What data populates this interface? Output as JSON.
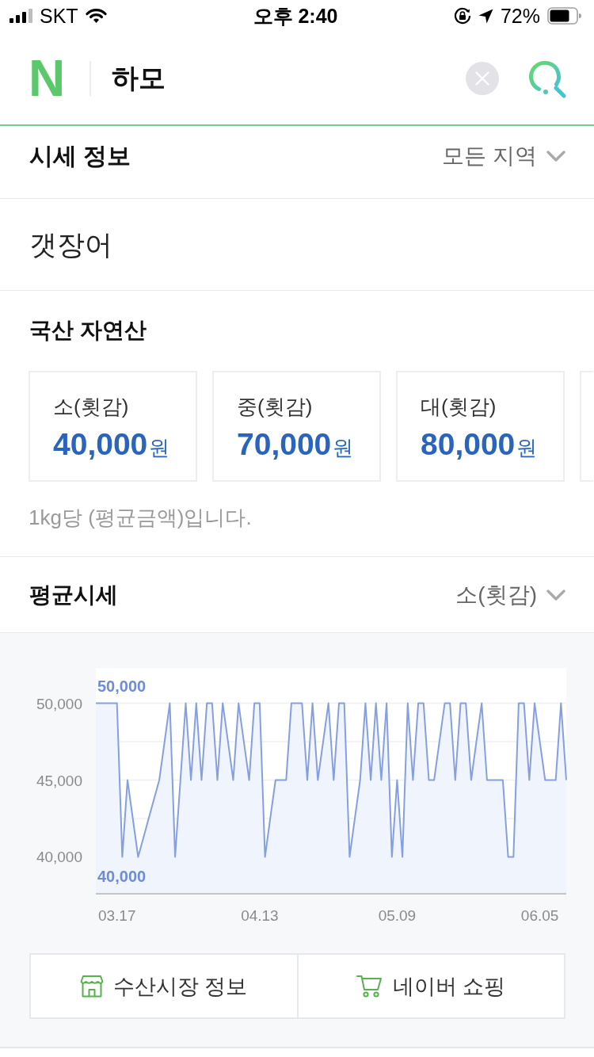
{
  "status_bar": {
    "carrier": "SKT",
    "time": "오후 2:40",
    "battery": "72%"
  },
  "header": {
    "logo": "N",
    "query": "하모"
  },
  "price_info": {
    "title": "시세 정보",
    "region": "모든 지역"
  },
  "species": {
    "name": "갯장어"
  },
  "origin": {
    "title": "국산 자연산",
    "cards": [
      {
        "label": "소(횟감)",
        "price": "40,000",
        "unit": "원"
      },
      {
        "label": "중(횟감)",
        "price": "70,000",
        "unit": "원"
      },
      {
        "label": "대(횟감)",
        "price": "80,000",
        "unit": "원"
      }
    ],
    "note": "1kg당 (평균금액)입니다."
  },
  "average": {
    "title": "평균시세",
    "size": "소(횟감)",
    "chart_data": {
      "type": "area",
      "categories": [
        null,
        null,
        null,
        null,
        "03.17",
        null,
        null,
        null,
        null,
        null,
        null,
        null,
        null,
        null,
        null,
        null,
        null,
        null,
        null,
        null,
        null,
        null,
        null,
        null,
        null,
        null,
        null,
        null,
        null,
        null,
        null,
        "04.13",
        null,
        null,
        null,
        null,
        null,
        null,
        null,
        null,
        null,
        null,
        null,
        null,
        null,
        null,
        null,
        null,
        null,
        null,
        null,
        null,
        null,
        null,
        null,
        null,
        null,
        "05.09",
        null,
        null,
        null,
        null,
        null,
        null,
        null,
        null,
        null,
        null,
        null,
        null,
        null,
        null,
        null,
        null,
        null,
        null,
        null,
        null,
        null,
        null,
        null,
        null,
        null,
        null,
        "06.05",
        null,
        null,
        null,
        null,
        null
      ],
      "values": [
        50000,
        50000,
        50000,
        50000,
        50000,
        40000,
        45000,
        42500,
        40000,
        41250,
        42500,
        43750,
        45000,
        47500,
        50000,
        40000,
        45000,
        50000,
        45000,
        50000,
        45000,
        50000,
        50000,
        45000,
        50000,
        47500,
        45000,
        50000,
        47500,
        45000,
        50000,
        50000,
        40000,
        42500,
        45000,
        45000,
        45000,
        50000,
        50000,
        50000,
        45000,
        50000,
        45000,
        47500,
        50000,
        45000,
        50000,
        50000,
        40000,
        42500,
        45000,
        50000,
        45000,
        50000,
        45000,
        50000,
        40000,
        45000,
        40000,
        50000,
        45000,
        50000,
        50000,
        45000,
        45000,
        47500,
        50000,
        50000,
        45000,
        50000,
        50000,
        45000,
        47500,
        50000,
        45000,
        45000,
        45000,
        45000,
        40000,
        40000,
        50000,
        50000,
        45000,
        50000,
        47500,
        45000,
        45000,
        45000,
        50000,
        45000
      ],
      "ylim": [
        37600,
        52300
      ],
      "yticks": [
        {
          "value": 40000,
          "label": "40,000"
        },
        {
          "value": 45000,
          "label": "45,000"
        },
        {
          "value": 50000,
          "label": "50,000"
        }
      ],
      "annotations": [
        {
          "text": "50,000",
          "y": 50000
        },
        {
          "text": "40,000",
          "y": 40000
        }
      ]
    }
  },
  "buttons": [
    {
      "kind": "market",
      "label": "수산시장 정보"
    },
    {
      "kind": "shopping",
      "label": "네이버 쇼핑"
    }
  ]
}
